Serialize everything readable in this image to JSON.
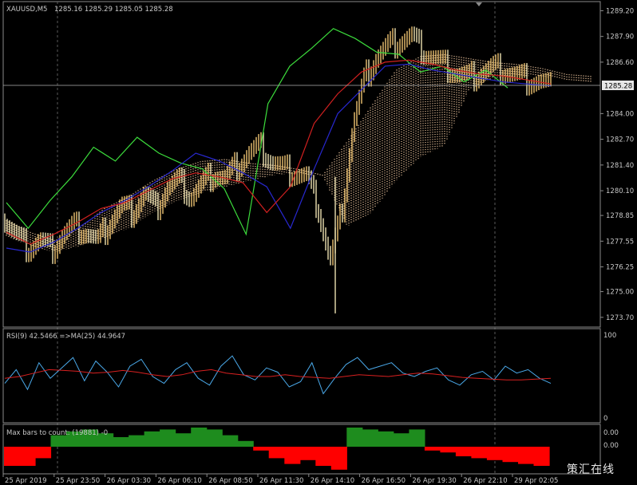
{
  "main_header": {
    "symbol": "XAUUSD,M5",
    "ohlc": "1285.16 1285.29 1285.05 1285.28"
  },
  "rsi_header": "RSI(9) 42.5466 =>MA(25) 44.9647",
  "bars_header": "Max bars to count: (19881) -0",
  "watermark": "策汇在线",
  "colors": {
    "background": "#000000",
    "frame": "#8a8a8a",
    "grid": "#5a5a5a",
    "candle_up": "#ffd27a",
    "candle_down": "#fff3c0",
    "green_line": "#3cdc3c",
    "blue_line": "#2828d0",
    "red_line": "#d02020",
    "cloud_a": "#f0c8a0",
    "cloud_b": "#ffffff",
    "rsi": "#4aa8e8",
    "rsi_ma": "#d82020",
    "hist_pos": "#1e8c1e",
    "hist_neg": "#ff0000"
  },
  "chart_data": [
    {
      "type": "line",
      "panel": "price",
      "price_axis": {
        "ticks": [
          "1289.20",
          "1287.90",
          "1286.60",
          "1285.28",
          "1284.00",
          "1282.70",
          "1281.40",
          "1280.10",
          "1278.85",
          "1277.55",
          "1276.25",
          "1275.00",
          "1273.70"
        ],
        "current_price": "1285.28",
        "ylim": [
          1273.45,
          1289.5
        ]
      },
      "time_axis": [
        "25 Apr 2019",
        "25 Apr 23:50",
        "26 Apr 03:30",
        "26 Apr 06:10",
        "26 Apr 08:50",
        "26 Apr 11:30",
        "26 Apr 14:10",
        "26 Apr 16:50",
        "26 Apr 19:30",
        "26 Apr 22:10",
        "29 Apr 02:05"
      ],
      "series": [
        {
          "role": "close",
          "values": [
            1278.6,
            1277.8,
            1277.2,
            1277.6,
            1277.1,
            1277.9,
            1278.3,
            1278.0,
            1277.5,
            1278.5,
            1279.3,
            1279.0,
            1280.0,
            1279.2,
            1280.3,
            1280.6,
            1279.8,
            1280.4,
            1281.0,
            1280.7,
            1281.4,
            1282.0,
            1282.3,
            1281.6,
            1281.2,
            1281.0,
            1280.8,
            1279.2,
            1276.5,
            1279.0,
            1283.5,
            1285.8,
            1286.9,
            1287.4,
            1287.7,
            1287.9,
            1287.2,
            1286.8,
            1286.4,
            1286.0,
            1285.8,
            1286.1,
            1286.3,
            1286.2,
            1285.9,
            1285.7,
            1285.6,
            1285.3
          ]
        },
        {
          "role": "green line",
          "values": [
            1279.5,
            1278.2,
            1279.6,
            1280.8,
            1282.3,
            1281.6,
            1282.8,
            1282.0,
            1281.5,
            1281.2,
            1280.2,
            1277.9,
            1284.5,
            1286.4,
            1287.3,
            1288.3,
            1287.8,
            1287.1,
            1287.0,
            1286.1,
            1286.4,
            1285.6,
            1286.2,
            1285.3
          ]
        },
        {
          "role": "blue line",
          "values": [
            1277.2,
            1277.0,
            1277.5,
            1278.2,
            1279.0,
            1279.6,
            1280.3,
            1281.1,
            1282.0,
            1281.6,
            1281.0,
            1280.3,
            1278.2,
            1281.2,
            1284.0,
            1285.2,
            1286.4,
            1286.5,
            1286.2,
            1286.0,
            1285.8,
            1285.6,
            1285.5,
            1285.4
          ]
        },
        {
          "role": "red line",
          "values": [
            1278.0,
            1277.4,
            1277.9,
            1278.5,
            1279.2,
            1279.5,
            1280.1,
            1280.7,
            1281.0,
            1280.8,
            1280.5,
            1279.0,
            1280.3,
            1283.5,
            1285.0,
            1286.1,
            1286.6,
            1286.7,
            1286.5,
            1286.2,
            1286.0,
            1285.9,
            1285.7,
            1285.5
          ]
        },
        {
          "role": "cloud upper",
          "values": [
            1278.6,
            1278.0,
            1277.6,
            1278.2,
            1279.2,
            1279.8,
            1280.6,
            1281.2,
            1281.6,
            1281.7,
            1281.5,
            1281.4,
            1281.2,
            1280.9,
            1282.6,
            1284.4,
            1286.2,
            1286.9,
            1287.0,
            1286.8,
            1286.6,
            1286.5,
            1286.3,
            1286.0,
            1285.9
          ]
        },
        {
          "role": "cloud lower",
          "values": [
            1277.8,
            1277.3,
            1277.0,
            1277.3,
            1277.7,
            1278.2,
            1279.0,
            1279.6,
            1280.0,
            1280.3,
            1280.6,
            1280.9,
            1281.0,
            1280.8,
            1278.3,
            1279.0,
            1280.6,
            1281.8,
            1282.4,
            1285.2,
            1285.8,
            1285.9,
            1285.9,
            1285.7,
            1285.6
          ]
        }
      ]
    },
    {
      "type": "line",
      "panel": "rsi",
      "ylim": [
        0,
        100
      ],
      "yticks": [
        "100",
        "0"
      ],
      "series": [
        {
          "name": "RSI(9)",
          "values": [
            42,
            58,
            35,
            66,
            48,
            60,
            72,
            45,
            68,
            55,
            38,
            62,
            70,
            50,
            42,
            58,
            66,
            48,
            40,
            62,
            74,
            52,
            46,
            60,
            55,
            38,
            44,
            66,
            30,
            48,
            64,
            72,
            58,
            62,
            66,
            54,
            50,
            56,
            60,
            46,
            40,
            52,
            56,
            46,
            62,
            54,
            58,
            48,
            42
          ]
        },
        {
          "name": "MA(25)",
          "values": [
            48,
            50,
            54,
            58,
            57,
            56,
            54,
            55,
            57,
            55,
            52,
            50,
            52,
            56,
            58,
            54,
            52,
            50,
            50,
            52,
            50,
            49,
            48,
            50,
            52,
            51,
            50,
            52,
            54,
            53,
            51,
            49,
            48,
            47,
            46,
            46,
            47,
            48
          ]
        }
      ]
    },
    {
      "type": "bar",
      "panel": "histogram",
      "yticks": [
        "0.00",
        "0.00"
      ],
      "values": [
        -1.0,
        -1.0,
        -0.6,
        0.6,
        0.8,
        0.9,
        0.7,
        0.5,
        0.6,
        0.8,
        0.9,
        0.7,
        1.0,
        0.9,
        0.6,
        0.3,
        -0.2,
        -0.6,
        -0.9,
        -0.7,
        -1.0,
        -1.2,
        1.0,
        0.9,
        0.8,
        0.7,
        0.9,
        -0.2,
        -0.3,
        -0.5,
        -0.6,
        -0.7,
        -0.8,
        -0.9,
        -1.0
      ]
    }
  ]
}
